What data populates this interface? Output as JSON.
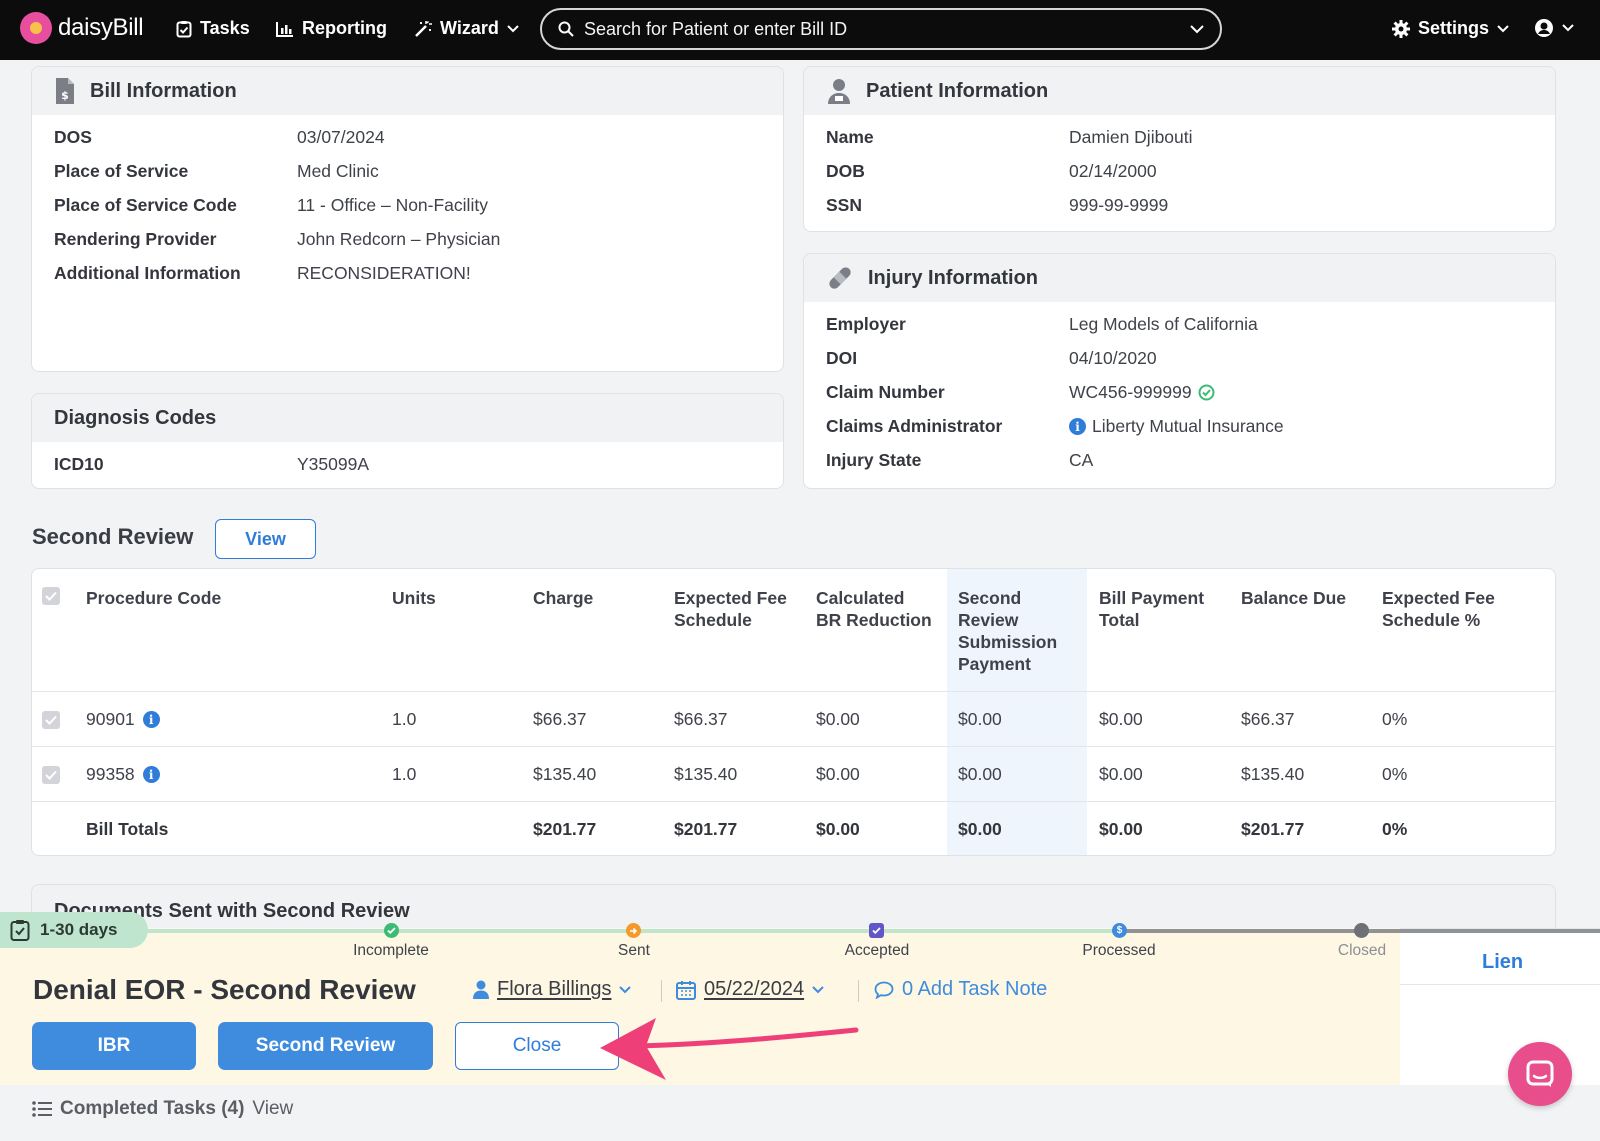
{
  "nav": {
    "brand": "daisyBill",
    "tasks": "Tasks",
    "reporting": "Reporting",
    "wizard": "Wizard",
    "search_placeholder": "Search for Patient or enter Bill ID",
    "settings": "Settings"
  },
  "bill_info": {
    "title": "Bill Information",
    "rows": [
      {
        "label": "DOS",
        "value": "03/07/2024"
      },
      {
        "label": "Place of Service",
        "value": "Med Clinic"
      },
      {
        "label": "Place of Service Code",
        "value": "11 - Office – Non-Facility"
      },
      {
        "label": "Rendering Provider",
        "value": "John Redcorn – Physician"
      },
      {
        "label": "Additional Information",
        "value": "RECONSIDERATION!"
      }
    ]
  },
  "patient_info": {
    "title": "Patient Information",
    "rows": [
      {
        "label": "Name",
        "value": "Damien Djibouti"
      },
      {
        "label": "DOB",
        "value": "02/14/2000"
      },
      {
        "label": "SSN",
        "value": "999-99-9999"
      }
    ]
  },
  "injury_info": {
    "title": "Injury Information",
    "rows": [
      {
        "label": "Employer",
        "value": "Leg Models of California"
      },
      {
        "label": "DOI",
        "value": "04/10/2020"
      },
      {
        "label": "Claim Number",
        "value": "WC456-999999"
      },
      {
        "label": "Claims Administrator",
        "value": "Liberty Mutual Insurance"
      },
      {
        "label": "Injury State",
        "value": "CA"
      }
    ]
  },
  "diagnosis": {
    "title": "Diagnosis Codes",
    "label": "ICD10",
    "value": "Y35099A"
  },
  "second_review": {
    "title": "Second Review",
    "view_button": "View",
    "columns": {
      "procedure": "Procedure Code",
      "units": "Units",
      "charge": "Charge",
      "expected": [
        "Expected Fee",
        "Schedule"
      ],
      "calculated": [
        "Calculated",
        "BR Reduction"
      ],
      "srsp": [
        "Second",
        "Review",
        "Submission",
        "Payment"
      ],
      "bpt": [
        "Bill Payment",
        "Total"
      ],
      "balance": "Balance Due",
      "pct": [
        "Expected Fee",
        "Schedule %"
      ]
    },
    "rows": [
      {
        "code": "90901",
        "units": "1.0",
        "charge": "$66.37",
        "expected": "$66.37",
        "calculated": "$0.00",
        "srsp": "$0.00",
        "bpt": "$0.00",
        "balance": "$66.37",
        "pct": "0%"
      },
      {
        "code": "99358",
        "units": "1.0",
        "charge": "$135.40",
        "expected": "$135.40",
        "calculated": "$0.00",
        "srsp": "$0.00",
        "bpt": "$0.00",
        "balance": "$135.40",
        "pct": "0%"
      }
    ],
    "totals": {
      "label": "Bill Totals",
      "charge": "$201.77",
      "expected": "$201.77",
      "calculated": "$0.00",
      "srsp": "$0.00",
      "bpt": "$0.00",
      "balance": "$201.77",
      "pct": "0%"
    }
  },
  "documents": {
    "title": "Documents Sent with Second Review"
  },
  "task": {
    "days_badge": "1-30 days",
    "stages": [
      "Incomplete",
      "Sent",
      "Accepted",
      "Processed",
      "Closed"
    ],
    "title": "Denial EOR - Second Review",
    "assignee": "Flora Billings",
    "date": "05/22/2024",
    "note": "0 Add Task Note",
    "buttons": {
      "ibr": "IBR",
      "second_review": "Second Review",
      "close": "Close"
    },
    "lien": "Lien"
  },
  "completed": {
    "label": "Completed Tasks (4)",
    "view": "View"
  },
  "colors": {
    "accent": "#2f7dd9",
    "arrow": "#ef3f78",
    "task_bg": "#fdf7e3",
    "badge": "#bfe5cf"
  }
}
